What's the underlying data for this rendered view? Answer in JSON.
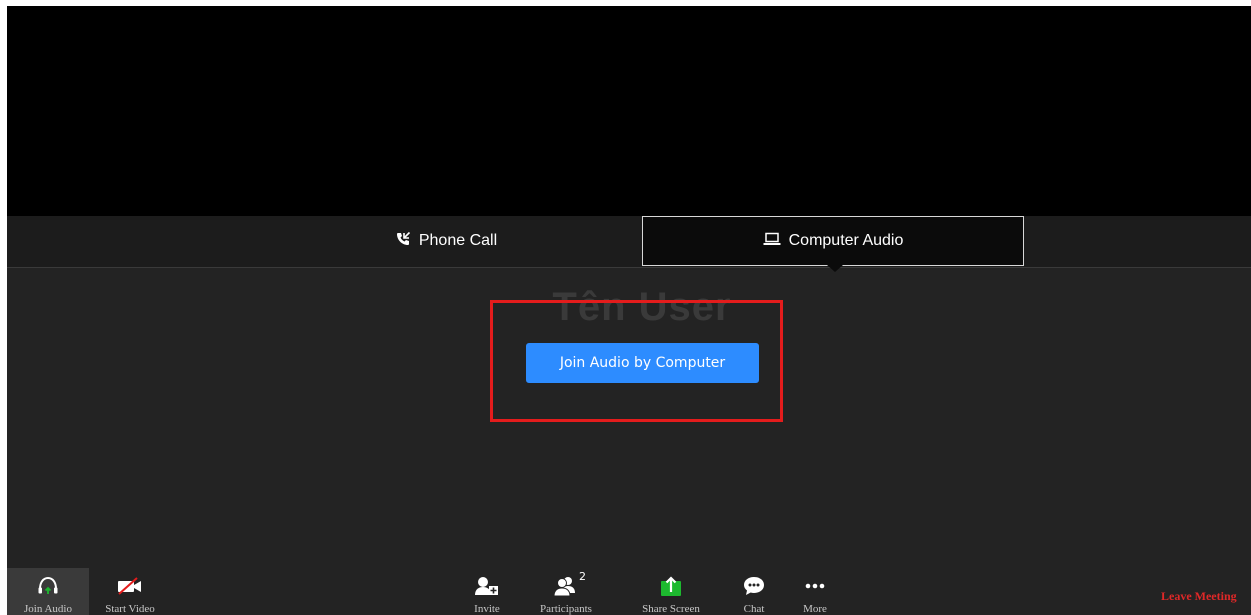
{
  "audio_tabs": {
    "phone": "Phone Call",
    "computer": "Computer Audio"
  },
  "participant": {
    "name": "Tên User"
  },
  "join_button": "Join Audio by Computer",
  "toolbar": {
    "join_audio": "Join Audio",
    "start_video": "Start Video",
    "invite": "Invite",
    "participants": "Participants",
    "participants_count": "2",
    "share_screen": "Share Screen",
    "chat": "Chat",
    "more": "More",
    "leave": "Leave Meeting"
  },
  "colors": {
    "accent": "#2d8cff",
    "highlight": "#e41c1c",
    "share_green": "#1db92f",
    "leave_red": "#e02828"
  },
  "icons": {
    "phone": "phone-call-icon",
    "computer": "laptop-icon",
    "join_audio": "headphones-icon",
    "start_video": "video-off-icon",
    "invite": "invite-user-icon",
    "participants": "participants-icon",
    "share": "share-screen-icon",
    "chat": "chat-bubble-icon",
    "more": "more-dots-icon"
  }
}
